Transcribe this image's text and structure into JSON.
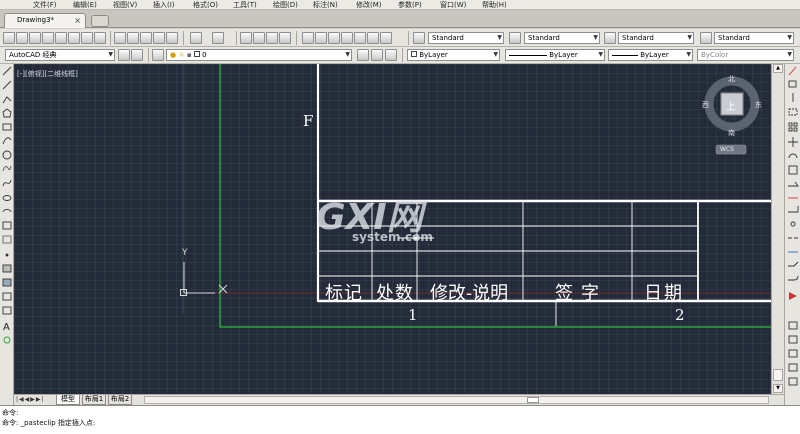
{
  "menu": [
    "文件(F)",
    "编辑(E)",
    "视图(V)",
    "插入(I)",
    "格式(O)",
    "工具(T)",
    "绘图(D)",
    "标注(N)",
    "修改(M)",
    "参数(P)",
    "窗口(W)",
    "帮助(H)"
  ],
  "document_tab": "Drawing3*",
  "styles": {
    "text_style": "Standard",
    "dim_style": "Standard",
    "table_style": "Standard",
    "multileader_style": "Standard"
  },
  "workspace": "AutoCAD 经典",
  "layer": "0",
  "properties": {
    "color": "ByLayer",
    "linetype": "ByLayer",
    "lineweight": "ByLayer",
    "plot_style": "ByColor"
  },
  "viewport_label": "[-][俯视][二维线框]",
  "viewcube": {
    "north": "北",
    "south": "南",
    "east": "东",
    "west": "西",
    "top": "上",
    "wcs": "WCS"
  },
  "drawing": {
    "zone_letter": "F",
    "title_block_headers": [
      "标记",
      "处数",
      "修改-说明",
      "签字",
      "日期"
    ],
    "column_numbers": [
      "1",
      "2"
    ],
    "ucs_y": "Y",
    "watermark_main": "GXI网",
    "watermark_sub": "system.com"
  },
  "layout_tabs": [
    "模型",
    "布局1",
    "布局2"
  ],
  "command": {
    "line1": "命令:",
    "line2": "命令: _pasteclip 指定插入点:"
  },
  "colors": {
    "canvas": "#232b3a",
    "green_border": "#2bbd3c",
    "white_line": "#ffffff",
    "red_axis": "#7a2a2a"
  }
}
